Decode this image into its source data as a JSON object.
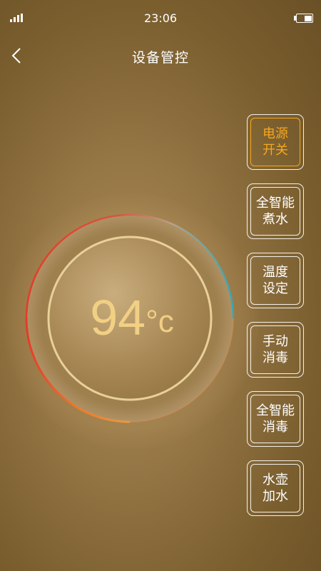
{
  "status_bar": {
    "time": "23:06",
    "signal_icon": "signal-bars-icon",
    "battery_icon": "battery-icon"
  },
  "nav": {
    "title": "设备管控",
    "back_icon": "chevron-left-icon"
  },
  "dial": {
    "temperature": "94",
    "unit": "°c",
    "ring_colors": [
      "#e63a28",
      "#f07a2a",
      "#3aa6b4"
    ],
    "text_color": "#f1cf84"
  },
  "controls": [
    {
      "label": "电源\n开关",
      "active": true
    },
    {
      "label": "全智能\n煮水",
      "active": false
    },
    {
      "label": "温度\n设定",
      "active": false
    },
    {
      "label": "手动\n消毒",
      "active": false
    },
    {
      "label": "全智能\n消毒",
      "active": false
    },
    {
      "label": "水壶\n加水",
      "active": false
    }
  ],
  "accent_color": "#f6a71f"
}
